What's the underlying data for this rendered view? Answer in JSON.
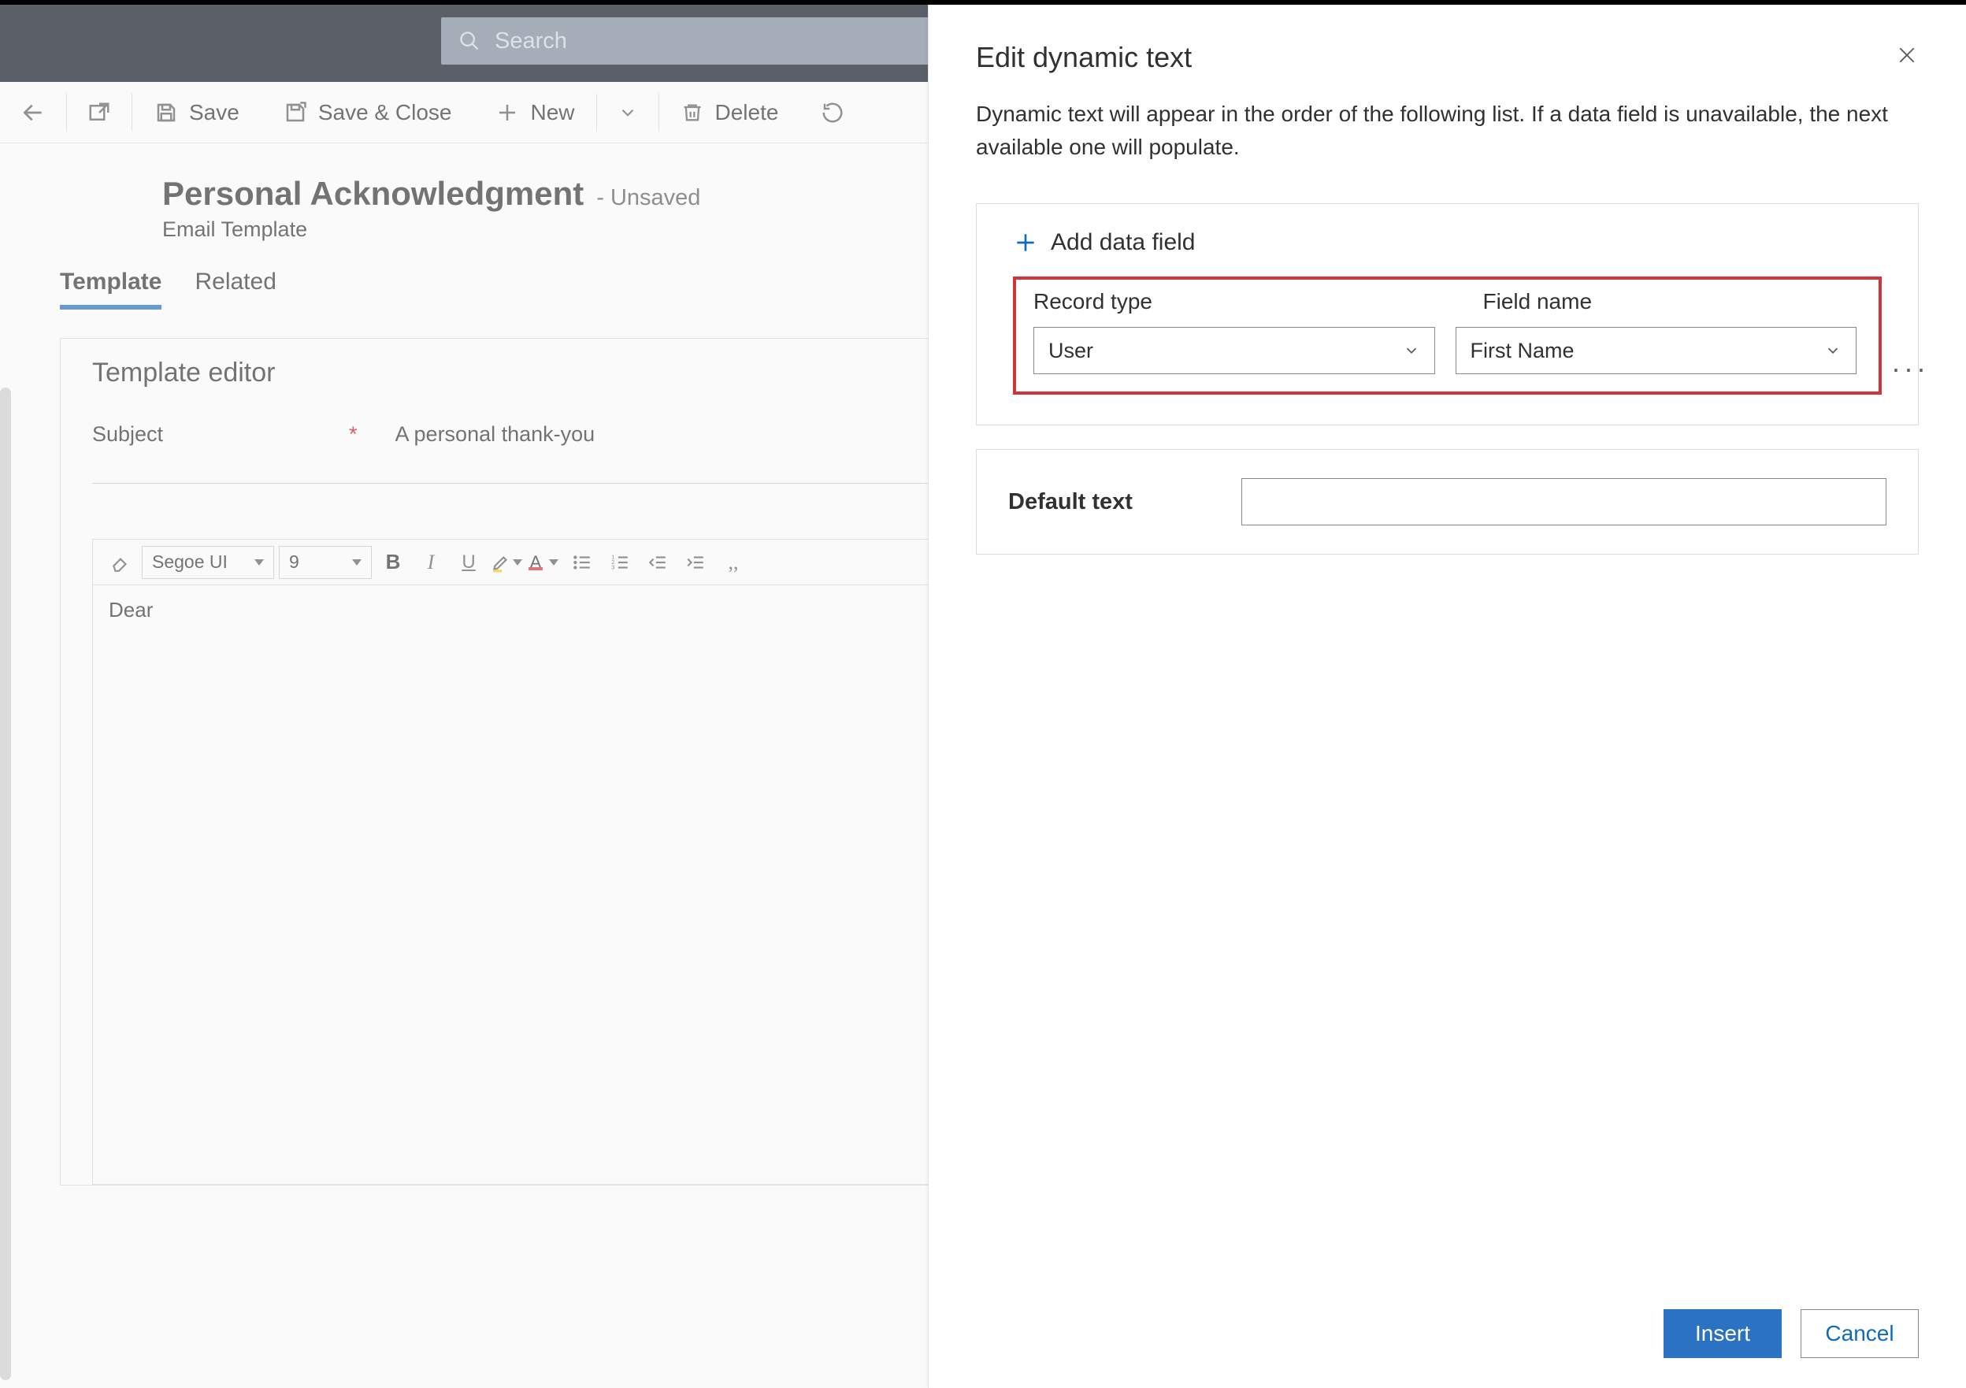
{
  "top": {
    "search_placeholder": "Search"
  },
  "cmd": {
    "save": "Save",
    "save_close": "Save & Close",
    "new": "New",
    "delete": "Delete"
  },
  "page": {
    "title": "Personal Acknowledgment",
    "state": "- Unsaved",
    "subtitle": "Email Template"
  },
  "tabs": {
    "template": "Template",
    "related": "Related"
  },
  "editor": {
    "section_title": "Template editor",
    "subject_label": "Subject",
    "subject_value": "A personal thank-you",
    "font": "Segoe UI",
    "font_size": "9",
    "body": "Dear"
  },
  "panel": {
    "title": "Edit dynamic text",
    "description": "Dynamic text will appear in the order of the following list. If a data field is unavailable, the next available one will populate.",
    "add_label": "Add data field",
    "record_type_label": "Record type",
    "field_name_label": "Field name",
    "record_type_value": "User",
    "field_name_value": "First Name",
    "default_text_label": "Default text",
    "default_text_value": "",
    "insert": "Insert",
    "cancel": "Cancel"
  }
}
